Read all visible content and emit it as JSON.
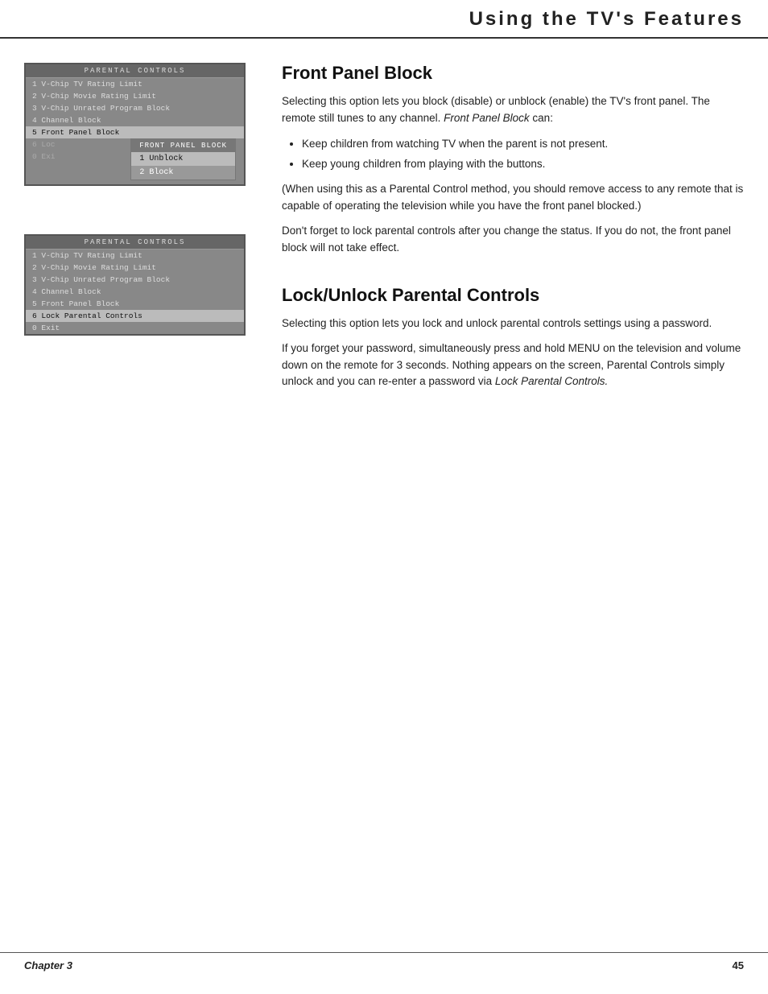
{
  "header": {
    "title": "Using the TV's Features"
  },
  "screen1": {
    "header": "PARENTAL  CONTROLS",
    "items": [
      {
        "num": "1",
        "label": "V-Chip TV Rating Limit",
        "state": "normal"
      },
      {
        "num": "2",
        "label": "V-Chip Movie Rating Limit",
        "state": "normal"
      },
      {
        "num": "3",
        "label": "V-Chip Unrated Program Block",
        "state": "normal"
      },
      {
        "num": "4",
        "label": "Channel Block",
        "state": "normal"
      },
      {
        "num": "5",
        "label": "Front Panel Block",
        "state": "highlighted"
      },
      {
        "num": "6",
        "label": "Loc",
        "state": "dimmed"
      },
      {
        "num": "0",
        "label": "Exi",
        "state": "dimmed"
      }
    ],
    "submenu": {
      "header": "FRONT PANEL BLOCK",
      "items": [
        {
          "num": "1",
          "label": "Unblock",
          "state": "highlighted"
        },
        {
          "num": "2",
          "label": "Block",
          "state": "normal"
        }
      ]
    }
  },
  "screen2": {
    "header": "PARENTAL  CONTROLS",
    "items": [
      {
        "num": "1",
        "label": "V-Chip TV Rating Limit",
        "state": "normal"
      },
      {
        "num": "2",
        "label": "V-Chip Movie Rating Limit",
        "state": "normal"
      },
      {
        "num": "3",
        "label": "V-Chip Unrated Program Block",
        "state": "normal"
      },
      {
        "num": "4",
        "label": "Channel Block",
        "state": "normal"
      },
      {
        "num": "5",
        "label": "Front Panel Block",
        "state": "normal"
      },
      {
        "num": "6",
        "label": "Lock Parental Controls",
        "state": "highlighted"
      },
      {
        "num": "0",
        "label": "Exit",
        "state": "normal"
      }
    ]
  },
  "section1": {
    "heading": "Front Panel Block",
    "para1": "Selecting this option lets you block (disable) or unblock (enable) the TV's front panel. The remote still tunes to any channel. Front Panel Block can:",
    "bullets": [
      "Keep children from watching TV when the parent is not present.",
      "Keep young children from playing with the buttons."
    ],
    "para2": "(When using this as a Parental Control method, you should remove access to any remote that is capable of operating the television while you have the front panel blocked.)",
    "para3": "Don't forget to lock parental controls after you change the status. If you do not, the front panel block will not take effect."
  },
  "section2": {
    "heading": "Lock/Unlock Parental Controls",
    "para1": "Selecting this option lets you lock and unlock parental controls settings using a password.",
    "para2": "If you forget your password, simultaneously press and hold MENU on the television and volume down on the remote for 3 seconds. Nothing appears on the screen, Parental Controls simply unlock and you can re-enter a password via Lock Parental Controls."
  },
  "footer": {
    "chapter_label": "Chapter 3",
    "page_number": "45"
  }
}
